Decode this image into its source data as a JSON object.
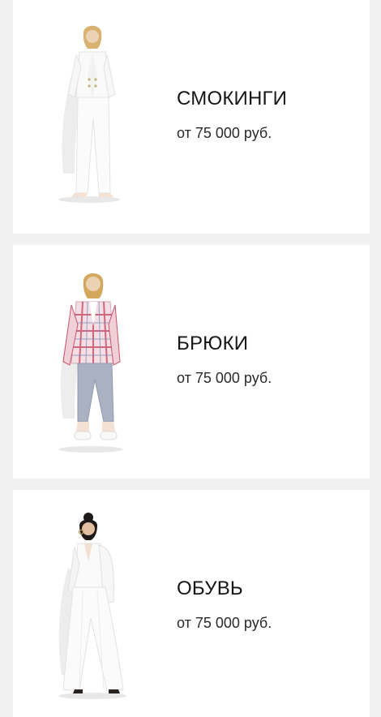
{
  "products": [
    {
      "title": "СМОКИНГИ",
      "price": "от 75 000 руб.",
      "image_icon": "white-tuxedo-model-icon"
    },
    {
      "title": "БРЮКИ",
      "price": "от 75 000 руб.",
      "image_icon": "checked-blazer-trousers-model-icon"
    },
    {
      "title": "ОБУВЬ",
      "price": "от 75 000 руб.",
      "image_icon": "white-suit-model-icon"
    }
  ],
  "colors": {
    "background": "#f1f1f1",
    "card": "#ffffff",
    "text": "#161616"
  }
}
